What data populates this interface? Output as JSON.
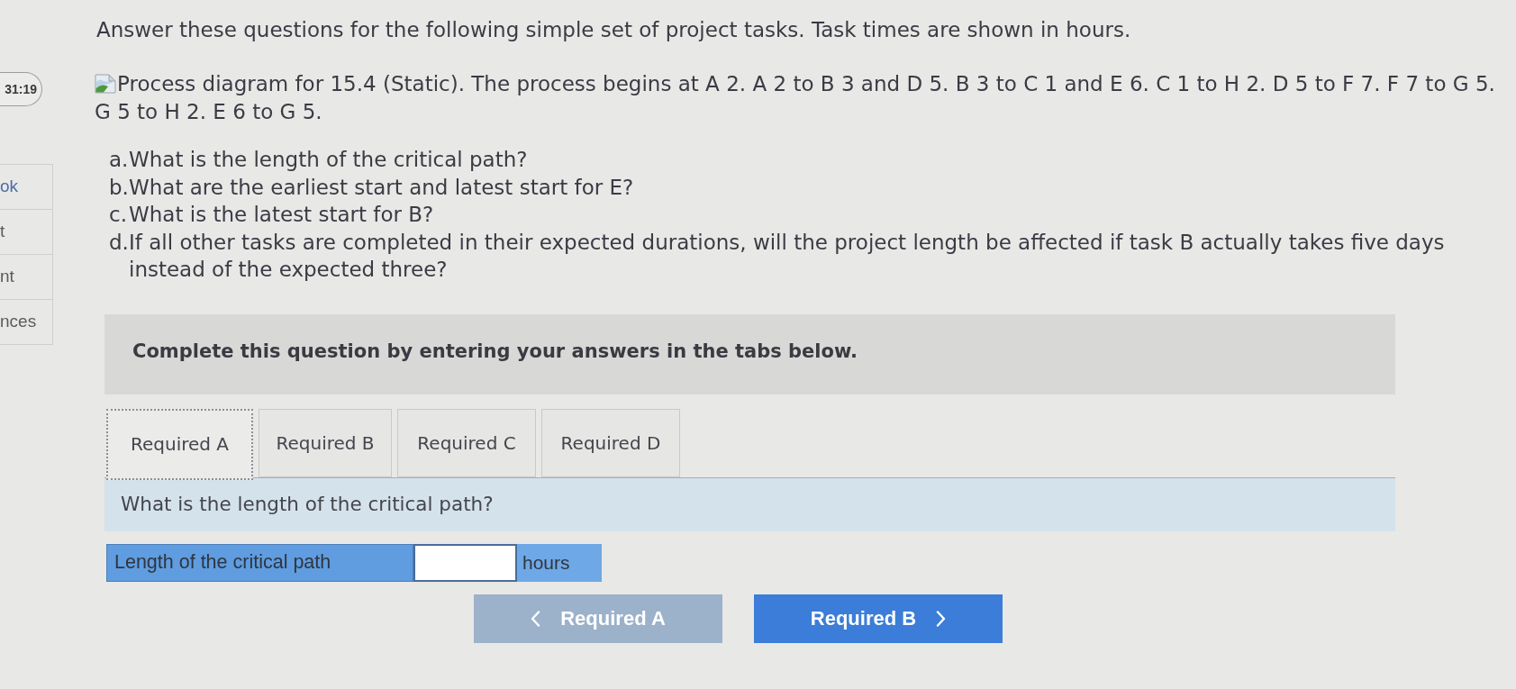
{
  "timer": {
    "text": "31:19"
  },
  "sidebar": {
    "items": [
      {
        "label": "ok",
        "color": "#4a6ea8"
      },
      {
        "label": "t",
        "color": "#5b5b60"
      },
      {
        "label": "nt",
        "color": "#5b5b60"
      },
      {
        "label": "nces",
        "color": "#5b5b60"
      }
    ]
  },
  "intro": "Answer these questions for the following simple set of project tasks. Task times are shown in hours.",
  "process_description": "Process diagram for 15.4 (Static). The process begins at A 2. A 2 to B 3 and D 5. B 3 to C 1 and E 6. C 1 to H 2. D 5 to F 7. F 7 to G 5. G 5 to H 2. E 6 to G 5.",
  "questions": [
    {
      "letter": "a.",
      "text": "What is the length of the critical path?"
    },
    {
      "letter": "b.",
      "text": "What are the earliest start and latest start for E?"
    },
    {
      "letter": "c.",
      "text": "What is the latest start for B?"
    },
    {
      "letter": "d.",
      "text": "If all other tasks are completed in their expected durations, will the project length be affected if task B actually takes five days instead of the expected three?"
    }
  ],
  "instructions": "Complete this question by entering your answers in the tabs below.",
  "tabs": [
    {
      "label": "Required A",
      "selected": true
    },
    {
      "label": "Required B",
      "selected": false
    },
    {
      "label": "Required C",
      "selected": false
    },
    {
      "label": "Required D",
      "selected": false
    }
  ],
  "prompt": "What is the length of the critical path?",
  "answer_row": {
    "label": "Length of the critical path",
    "unit": "hours"
  },
  "navigation": {
    "previous": {
      "label": "Required A",
      "disabled": true
    },
    "next": {
      "label": "Required B",
      "disabled": false
    }
  }
}
